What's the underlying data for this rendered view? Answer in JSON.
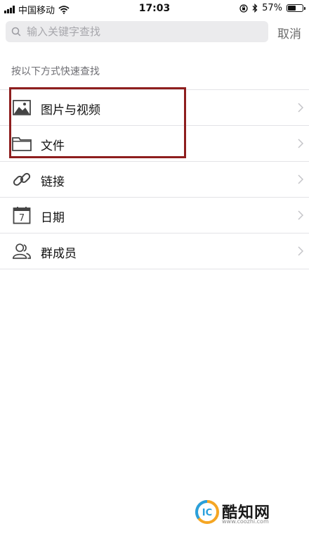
{
  "status_bar": {
    "carrier": "中国移动",
    "time": "17:03",
    "battery_text": "57%",
    "battery_level": 0.57,
    "icons": [
      "signal-icon",
      "wifi-icon",
      "orientation-lock-icon",
      "bluetooth-icon",
      "battery-icon"
    ]
  },
  "search": {
    "placeholder": "输入关键字查找",
    "value": "",
    "cancel_label": "取消"
  },
  "section_header": "按以下方式快速查找",
  "items": [
    {
      "label": "图片与视频",
      "icon": "image-icon"
    },
    {
      "label": "文件",
      "icon": "folder-icon"
    },
    {
      "label": "链接",
      "icon": "link-icon"
    },
    {
      "label": "日期",
      "icon": "calendar-icon",
      "icon_text": "7"
    },
    {
      "label": "群成员",
      "icon": "members-icon"
    }
  ],
  "highlight_color": "#8e1e1e",
  "watermark": {
    "name": "酷知网",
    "url": "www.coozhi.com"
  }
}
